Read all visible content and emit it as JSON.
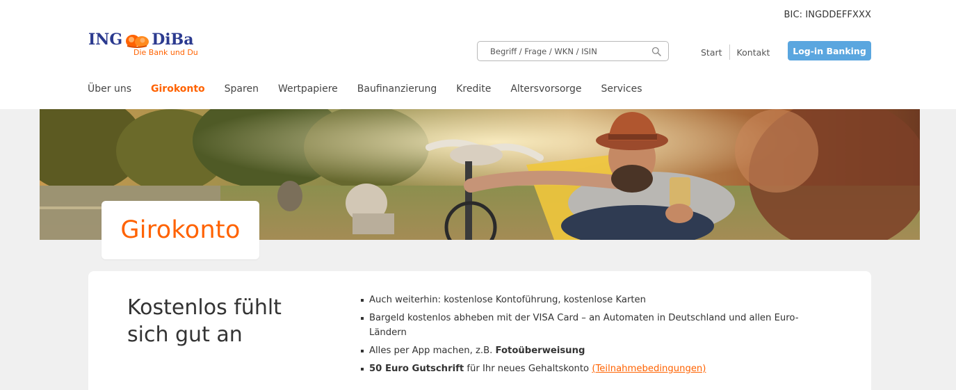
{
  "header": {
    "bic": "BIC: INGDDEFFXXX",
    "logo": {
      "part1": "ING",
      "part2": "DiBa",
      "tagline": "Die Bank und Du"
    },
    "search": {
      "placeholder": "Begriff / Frage / WKN / ISIN",
      "icon": "search-icon"
    },
    "links": {
      "start": "Start",
      "kontakt": "Kontakt"
    },
    "login_label": "Log-in Banking"
  },
  "nav": {
    "items": [
      "Über uns",
      "Girokonto",
      "Sparen",
      "Wertpapiere",
      "Baufinanzierung",
      "Kredite",
      "Altersvorsorge",
      "Services"
    ],
    "active": "Girokonto"
  },
  "hero": {
    "title": "Girokonto"
  },
  "content": {
    "heading_line1": "Kostenlos fühlt",
    "heading_line2": "sich gut an",
    "bullets": {
      "b1": "Auch weiterhin: kostenlose Kontoführung, kostenlose Karten",
      "b2": "Bargeld kostenlos abheben mit der VISA Card – an Automaten in Deutschland und allen Euro-Ländern",
      "b3_text": "Alles per App machen, z.B. ",
      "b3_bold": "Fotoüberweisung",
      "b4_bold": "50 Euro Gutschrift",
      "b4_text": " für Ihr neues Gehaltskonto ",
      "b4_link": "(Teilnahmebedingungen)"
    }
  },
  "colors": {
    "brand_orange": "#ff6200",
    "brand_blue": "#2b3a8f",
    "button_blue": "#5aa6df",
    "section_bg": "#f0f0f0"
  }
}
